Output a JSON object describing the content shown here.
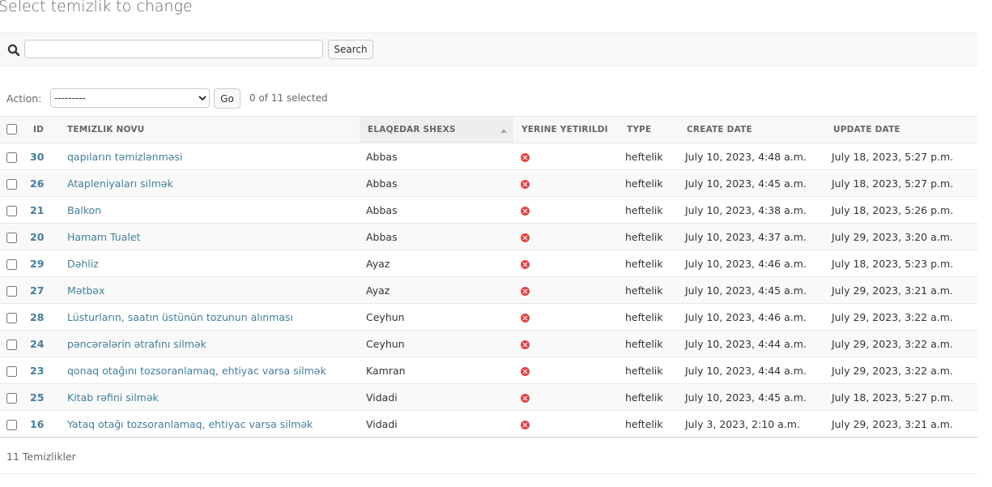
{
  "page_title": "Select temizlik to change",
  "search": {
    "value": "",
    "placeholder": "",
    "button_label": "Search",
    "icon": "magnifier"
  },
  "actions": {
    "label": "Action:",
    "selected_option": "---------",
    "go_label": "Go",
    "selection_count": "0 of 11 selected"
  },
  "table": {
    "columns": {
      "id": "ID",
      "temizlik_novu": "TEMIZLIK NOVU",
      "elaqedar_shexs": "ELAQEDAR SHEXS",
      "yerine_yetirildi": "YERINE YETIRILDI",
      "type": "TYPE",
      "create_date": "CREATE DATE",
      "update_date": "UPDATE DATE"
    },
    "sorted_column": "elaqedar_shexs",
    "sort_direction": "ascending",
    "rows": [
      {
        "id": "30",
        "temizlik_novu": "qapıların təmizlənməsi",
        "elaqedar_shexs": "Abbas",
        "yerine_yetirildi": false,
        "type": "heftelik",
        "create_date": "July 10, 2023, 4:48 a.m.",
        "update_date": "July 18, 2023, 5:27 p.m."
      },
      {
        "id": "26",
        "temizlik_novu": "Atapleniyaları silmək",
        "elaqedar_shexs": "Abbas",
        "yerine_yetirildi": false,
        "type": "heftelik",
        "create_date": "July 10, 2023, 4:45 a.m.",
        "update_date": "July 18, 2023, 5:27 p.m."
      },
      {
        "id": "21",
        "temizlik_novu": "Balkon",
        "elaqedar_shexs": "Abbas",
        "yerine_yetirildi": false,
        "type": "heftelik",
        "create_date": "July 10, 2023, 4:38 a.m.",
        "update_date": "July 18, 2023, 5:26 p.m."
      },
      {
        "id": "20",
        "temizlik_novu": "Hamam Tualet",
        "elaqedar_shexs": "Abbas",
        "yerine_yetirildi": false,
        "type": "heftelik",
        "create_date": "July 10, 2023, 4:37 a.m.",
        "update_date": "July 29, 2023, 3:20 a.m."
      },
      {
        "id": "29",
        "temizlik_novu": "Dəhliz",
        "elaqedar_shexs": "Ayaz",
        "yerine_yetirildi": false,
        "type": "heftelik",
        "create_date": "July 10, 2023, 4:46 a.m.",
        "update_date": "July 18, 2023, 5:23 p.m."
      },
      {
        "id": "27",
        "temizlik_novu": "Mətbəx",
        "elaqedar_shexs": "Ayaz",
        "yerine_yetirildi": false,
        "type": "heftelik",
        "create_date": "July 10, 2023, 4:45 a.m.",
        "update_date": "July 29, 2023, 3:21 a.m."
      },
      {
        "id": "28",
        "temizlik_novu": "Lüsturların, saatın üstünün tozunun alınması",
        "elaqedar_shexs": "Ceyhun",
        "yerine_yetirildi": false,
        "type": "heftelik",
        "create_date": "July 10, 2023, 4:46 a.m.",
        "update_date": "July 29, 2023, 3:22 a.m."
      },
      {
        "id": "24",
        "temizlik_novu": "pəncərələrin ətrafını silmək",
        "elaqedar_shexs": "Ceyhun",
        "yerine_yetirildi": false,
        "type": "heftelik",
        "create_date": "July 10, 2023, 4:44 a.m.",
        "update_date": "July 29, 2023, 3:22 a.m."
      },
      {
        "id": "23",
        "temizlik_novu": "qonaq otağını tozsoranlamaq, ehtiyac varsa silmək",
        "elaqedar_shexs": "Kamran",
        "yerine_yetirildi": false,
        "type": "heftelik",
        "create_date": "July 10, 2023, 4:44 a.m.",
        "update_date": "July 29, 2023, 3:22 a.m."
      },
      {
        "id": "25",
        "temizlik_novu": "Kitab rəfini silmək",
        "elaqedar_shexs": "Vidadi",
        "yerine_yetirildi": false,
        "type": "heftelik",
        "create_date": "July 10, 2023, 4:45 a.m.",
        "update_date": "July 18, 2023, 5:27 p.m."
      },
      {
        "id": "16",
        "temizlik_novu": "Yataq otağı tozsoranlamaq, ehtiyac varsa silmək",
        "elaqedar_shexs": "Vidadi",
        "yerine_yetirildi": false,
        "type": "heftelik",
        "create_date": "July 3, 2023, 2:10 a.m.",
        "update_date": "July 29, 2023, 3:21 a.m."
      }
    ]
  },
  "paginator": {
    "count_label": "11 Temizlikler"
  },
  "colors": {
    "link": "#447e9b",
    "boolean_no": "#dd4646",
    "header_bg": "#f8f8f8",
    "sorted_header_bg": "#eeeeee"
  }
}
